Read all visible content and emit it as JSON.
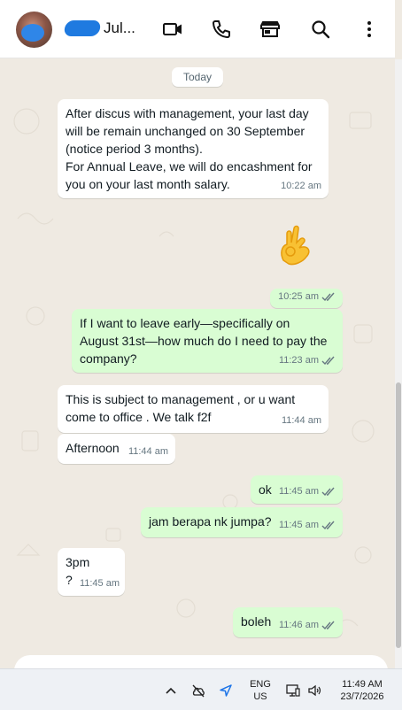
{
  "header": {
    "contact_name": "Jul...",
    "icons": [
      "video-icon",
      "phone-icon",
      "store-icon",
      "search-icon",
      "more-icon"
    ]
  },
  "chat": {
    "date_label": "Today",
    "messages": [
      {
        "dir": "in",
        "text": "After discus with management, your last day\nwill be remain unchanged on 30 September\n(notice period 3 months).\nFor Annual Leave, we will do encashment for\nyou on your last month salary.",
        "time": "10:22 am"
      },
      {
        "dir": "out",
        "text": "👌",
        "time": "10:25 am",
        "ticks": true
      },
      {
        "dir": "out",
        "text": "If I want to leave early—specifically on\nAugust 31st—how much do I need to pay the\ncompany?",
        "time": "11:23 am",
        "ticks": true
      },
      {
        "dir": "in",
        "text": "This is subject to management , or u want\ncome to office . We talk f2f",
        "time": "11:44 am"
      },
      {
        "dir": "in",
        "text": "Afternoon",
        "time": "11:44 am"
      },
      {
        "dir": "out",
        "text": "ok",
        "time": "11:45 am",
        "ticks": true
      },
      {
        "dir": "out",
        "text": "jam berapa nk jumpa?",
        "time": "11:45 am",
        "ticks": true
      },
      {
        "dir": "in",
        "text": "3pm\n?",
        "time": "11:45 am"
      },
      {
        "dir": "out",
        "text": "boleh",
        "time": "11:46 am",
        "ticks": true
      }
    ]
  },
  "taskbar": {
    "lang_line1": "ENG",
    "lang_line2": "US",
    "clock_time": "11:49 AM",
    "clock_date": "23/7/2026"
  },
  "colors": {
    "incoming": "#ffffff",
    "outgoing": "#d9fdd3",
    "background": "#efeae2",
    "tick": "#667781"
  }
}
